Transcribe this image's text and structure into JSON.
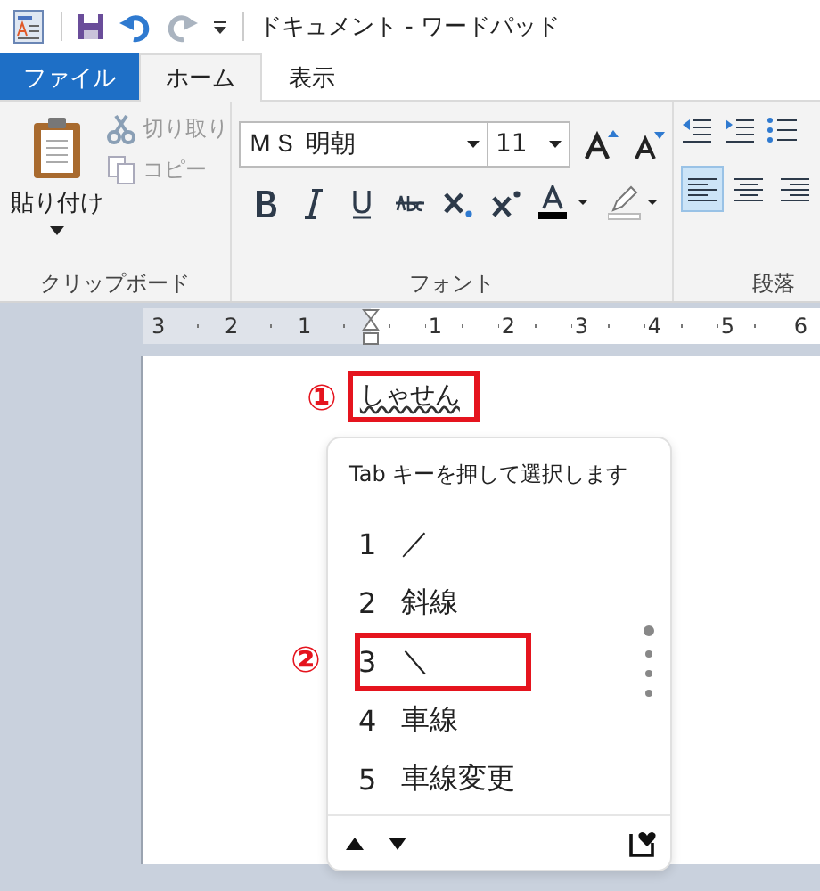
{
  "window": {
    "title": "ドキュメント - ワードパッド"
  },
  "tabs": [
    {
      "label": "ファイル",
      "kind": "file",
      "selected": false
    },
    {
      "label": "ホーム",
      "kind": "tab",
      "selected": true
    },
    {
      "label": "表示",
      "kind": "tab",
      "selected": false
    }
  ],
  "ribbon": {
    "clipboard": {
      "label": "クリップボード",
      "paste": "貼り付け",
      "cut": {
        "label": "切り取り",
        "disabled": true
      },
      "copy": {
        "label": "コピー",
        "disabled": true
      }
    },
    "font": {
      "label": "フォント",
      "font_name": "ＭＳ 明朝",
      "font_size": "11"
    },
    "paragraph": {
      "label": "段落",
      "align_buttons": [
        {
          "kind": "left",
          "selected": true
        },
        {
          "kind": "center",
          "selected": false
        },
        {
          "kind": "right",
          "selected": false
        }
      ]
    }
  },
  "ruler": {
    "left_labels": [
      "3",
      "2",
      "1"
    ],
    "right_labels": [
      "1",
      "2",
      "3",
      "4",
      "5",
      "6"
    ]
  },
  "document": {
    "text": "しゃせん",
    "annotation": "①"
  },
  "candidates": {
    "hint": "Tab キーを押して選択します",
    "annotation": "②",
    "items": [
      {
        "number": "1",
        "text": "／",
        "boxed": false
      },
      {
        "number": "2",
        "text": "斜線",
        "boxed": false
      },
      {
        "number": "3",
        "text": "＼",
        "boxed": true
      },
      {
        "number": "4",
        "text": "車線",
        "boxed": false
      },
      {
        "number": "5",
        "text": "車線変更",
        "boxed": false
      }
    ]
  }
}
